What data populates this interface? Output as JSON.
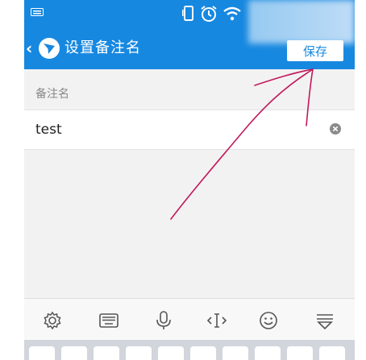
{
  "header": {
    "title": "设置备注名",
    "save_label": "保存",
    "back_glyph": "‹"
  },
  "form": {
    "section_label": "备注名",
    "remark_value": "test"
  },
  "colors": {
    "accent": "#1788e0",
    "annotation": "#c2185b"
  },
  "keyboard_toolbar": {
    "icons": [
      "gear-icon",
      "keyboard-icon",
      "microphone-icon",
      "cursor-move-icon",
      "emoji-icon",
      "collapse-keyboard-icon"
    ]
  }
}
